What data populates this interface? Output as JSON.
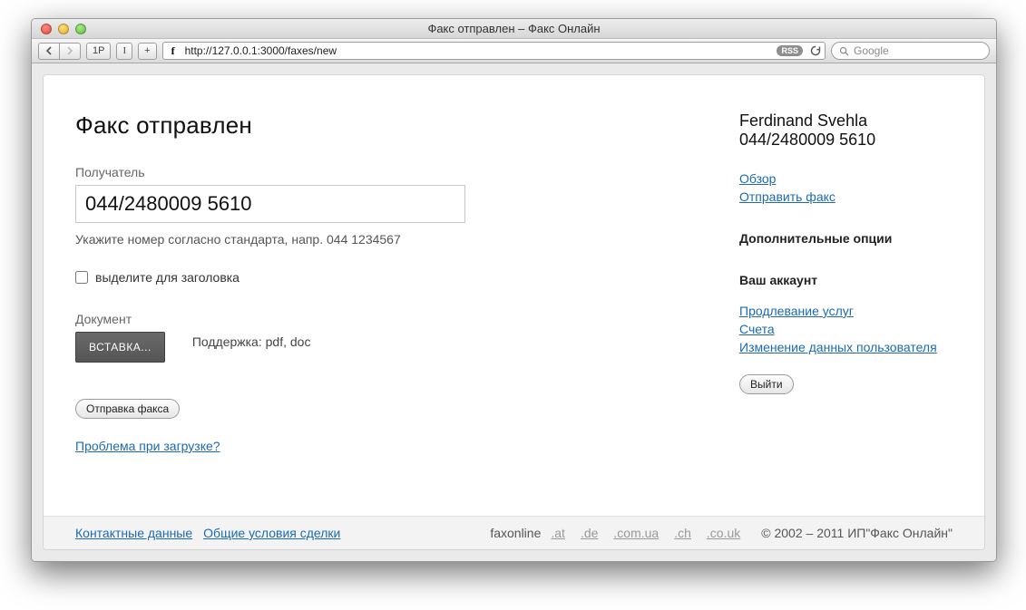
{
  "window": {
    "title": "Факс отправлен – Факс Онлайн"
  },
  "toolbar": {
    "onep": "1P",
    "i_btn": "I",
    "plus": "+",
    "url": "http://127.0.0.1:3000/faxes/new",
    "rss": "RSS",
    "search_placeholder": "Google"
  },
  "main": {
    "title": "Факс отправлен",
    "recipient_label": "Получатель",
    "recipient_value": "044/2480009 5610",
    "recipient_hint": "Укажите номер согласно стандарта, напр. 044 1234567",
    "header_checkbox_label": "выделите для заголовка",
    "document_label": "Документ",
    "upload_button": "ВСТАВКА...",
    "support_text": "Поддержка: pdf, doc",
    "send_button": "Отправка факса",
    "upload_problem_link": "Проблема при загрузке?"
  },
  "sidebar": {
    "user_name": "Ferdinand Svehla",
    "user_number": "044/2480009 5610",
    "nav": {
      "overview": "Обзор",
      "send_fax": "Отправить факс"
    },
    "options_heading": "Дополнительные опции",
    "account_heading": "Ваш аккаунт",
    "account_links": {
      "renew": "Продлевание услуг",
      "bills": "Счета",
      "edit_user": "Изменение данных пользователя"
    },
    "logout": "Выйти"
  },
  "footer": {
    "contact": "Контактные данные",
    "terms": "Общие условия сделки",
    "brand": "faxonline",
    "domains": {
      "at": ".at",
      "de": ".de",
      "comua": ".com.ua",
      "ch": ".ch",
      "couk": ".co.uk"
    },
    "copyright": "© 2002 – 2011 ИП\"Факс Онлайн\""
  }
}
